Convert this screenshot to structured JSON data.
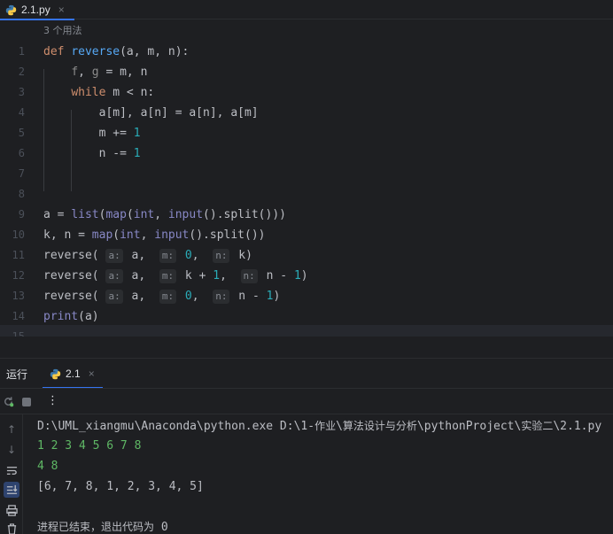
{
  "editor_tab": {
    "file_name": "2.1.py",
    "close": "×"
  },
  "editor": {
    "usage_hint": "3 个用法",
    "line_numbers": [
      "1",
      "2",
      "3",
      "4",
      "5",
      "6",
      "7",
      "8",
      "9",
      "10",
      "11",
      "12",
      "13",
      "14",
      "15"
    ],
    "lines": [
      "def reverse(a, m, n):",
      "    f, g = m, n",
      "    while m < n:",
      "        a[m], a[n] = a[n], a[m]",
      "        m += 1",
      "        n -= 1",
      "",
      "",
      "a = list(map(int, input().split()))",
      "k, n = map(int, input().split())",
      "reverse( a: a,  m: 0,  n: k)",
      "reverse( a: a,  m: k + 1,  n: n - 1)",
      "reverse( a: a,  m: 0,  n: n - 1)",
      "print(a)",
      ""
    ],
    "param_hints": {
      "a": "a:",
      "m": "m:",
      "n": "n:"
    }
  },
  "run_window": {
    "label": "运行",
    "tab_name": "2.1",
    "tab_close": "×",
    "more_label": "⋮"
  },
  "console": {
    "command_prefix": "D:\\UML_xiangmu\\Anaconda\\python.exe D:\\1-",
    "command_cjk_1": "作业",
    "command_sep1": "\\",
    "command_cjk_2": "算法设计与分析",
    "command_mid": "\\pythonProject\\",
    "command_cjk_3": "实验二",
    "command_suffix": "\\2.1.py",
    "input_1": "1 2 3 4 5 6 7 8",
    "input_2": "4 8",
    "output": "[6, 7, 8, 1, 2, 3, 4, 5]",
    "exit_message_cjk": "进程已结束，退出代码为",
    "exit_code": " 0"
  },
  "icons": [
    "python-file-icon",
    "rerun-icon",
    "stop-icon",
    "more-icon",
    "up-arrow-icon",
    "down-arrow-icon",
    "soft-wrap-icon",
    "scroll-to-end-icon",
    "print-icon",
    "trash-icon"
  ]
}
